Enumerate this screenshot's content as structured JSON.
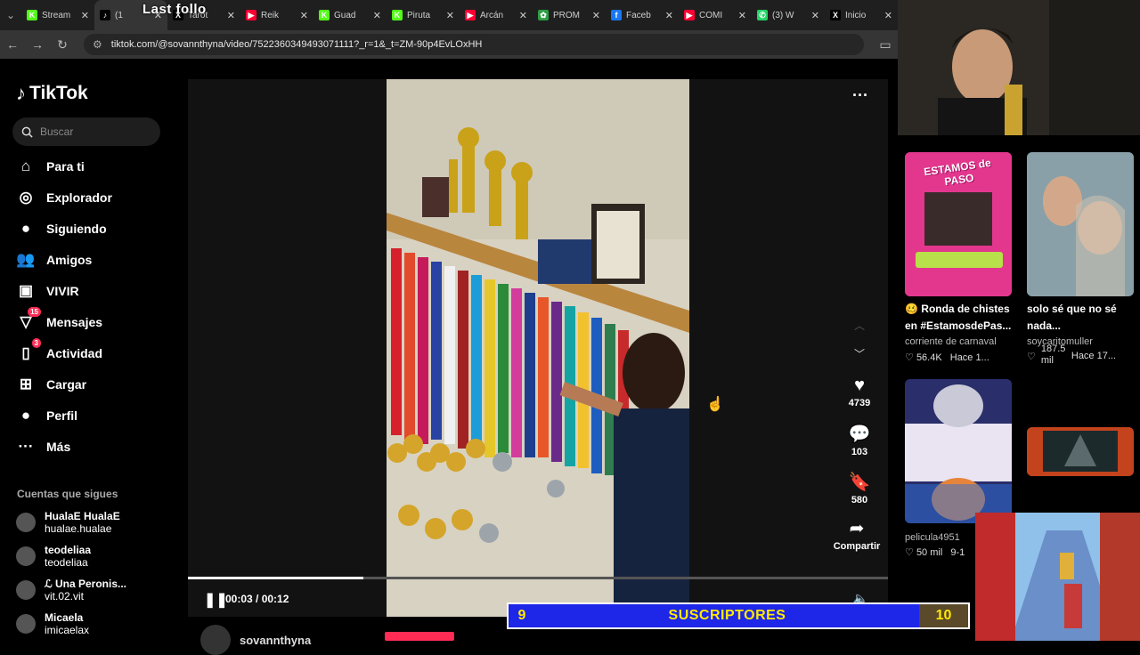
{
  "browser": {
    "tabs": [
      {
        "title": "Stream",
        "color": "#53fc18",
        "glyph": "K"
      },
      {
        "title": "(1",
        "color": "#000000",
        "glyph": "♪",
        "active": true
      },
      {
        "title": "Tarot",
        "color": "#000000",
        "glyph": "X"
      },
      {
        "title": "Reik",
        "color": "#ff0033",
        "glyph": "▶"
      },
      {
        "title": "Guad",
        "color": "#53fc18",
        "glyph": "K"
      },
      {
        "title": "Piruta",
        "color": "#53fc18",
        "glyph": "K"
      },
      {
        "title": "Arcán",
        "color": "#ff0033",
        "glyph": "▶"
      },
      {
        "title": "PROM",
        "color": "#2e9e44",
        "glyph": "✿"
      },
      {
        "title": "Faceb",
        "color": "#1877f2",
        "glyph": "f"
      },
      {
        "title": "COMI",
        "color": "#ff0033",
        "glyph": "▶"
      },
      {
        "title": "(3) W",
        "color": "#25d366",
        "glyph": "✆"
      },
      {
        "title": "Inicio",
        "color": "#000000",
        "glyph": "X"
      }
    ],
    "overlay_text": "Last follo",
    "url": "tiktok.com/@sovannthyna/video/7522360349493071111?_r=1&_t=ZM-90p4EvLOxHH"
  },
  "sidebar": {
    "logo": "TikTok",
    "search_placeholder": "Buscar",
    "nav": [
      {
        "label": "Para ti",
        "icon": "home-icon"
      },
      {
        "label": "Explorador",
        "icon": "compass-icon"
      },
      {
        "label": "Siguiendo",
        "icon": "following-avatar-icon"
      },
      {
        "label": "Amigos",
        "icon": "friends-icon"
      },
      {
        "label": "VIVIR",
        "icon": "live-icon"
      },
      {
        "label": "Mensajes",
        "icon": "messages-icon",
        "badge": "15"
      },
      {
        "label": "Actividad",
        "icon": "activity-icon",
        "badge": "3"
      },
      {
        "label": "Cargar",
        "icon": "upload-icon"
      },
      {
        "label": "Perfil",
        "icon": "profile-icon"
      },
      {
        "label": "Más",
        "icon": "more-icon"
      }
    ],
    "following_title": "Cuentas que sigues",
    "accounts": [
      {
        "name": "HualaE HualaE",
        "handle": "hualae.hualae"
      },
      {
        "name": "teodeliaa",
        "handle": "teodeliaa"
      },
      {
        "name": "ℒ Una Peronis...",
        "handle": "vit.02.vit"
      },
      {
        "name": "Micaela",
        "handle": "imicaelax"
      }
    ]
  },
  "player": {
    "time": "00:03 / 00:12",
    "progress": 0.25,
    "likes": "4739",
    "comments": "103",
    "saves": "580",
    "share_label": "Compartir",
    "author": "sovannthyna"
  },
  "recommended": [
    {
      "title": "🥴 Ronda de chistes en #EstamosdePas...",
      "author": "corriente de carnaval",
      "likes": "56.4K",
      "age": "Hace 1...",
      "thumb_text": "ESTAMOS de PASO"
    },
    {
      "title": "solo sé que no sé nada...",
      "author": "soycaritomuller",
      "likes": "187.5 mil",
      "age": "Hace 17..."
    },
    {
      "title": "",
      "author": "pelicula4951",
      "likes": "50 mil",
      "age": "9-1"
    }
  ],
  "stream_overlay": {
    "left_num": "9",
    "label": "SUSCRIPTORES",
    "right_num": "10"
  }
}
